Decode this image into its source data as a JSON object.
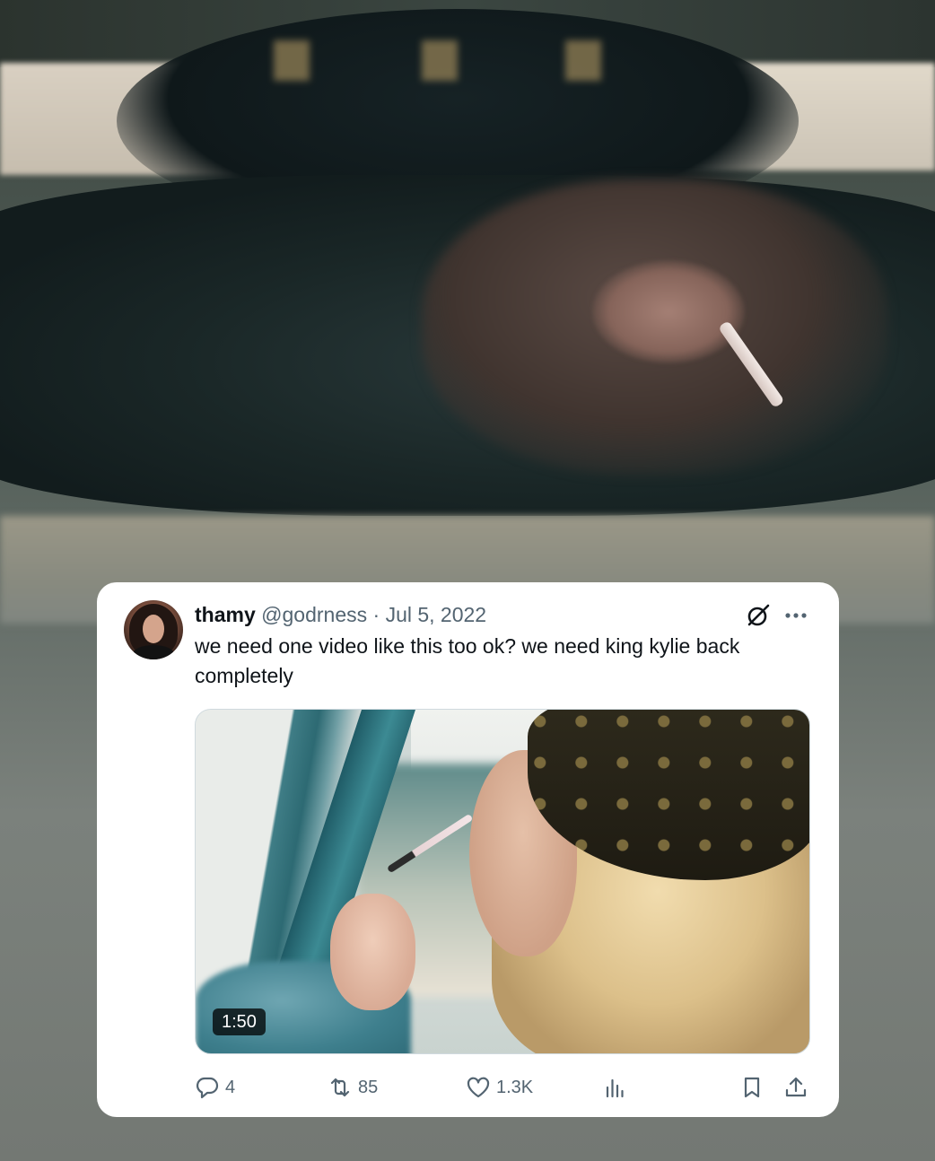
{
  "tweet": {
    "display_name": "thamy",
    "handle": "@godrness",
    "separator": "·",
    "date": "Jul 5, 2022",
    "text": "we need one video like this too ok? we need king kylie back completely",
    "media": {
      "duration": "1:50"
    },
    "stats": {
      "replies": "4",
      "reposts": "85",
      "likes": "1.3K"
    }
  },
  "colors": {
    "card_bg": "#ffffff",
    "text_primary": "#0f1419",
    "text_secondary": "#536471"
  },
  "icons": [
    "grok-icon",
    "more-icon",
    "reply-icon",
    "repost-icon",
    "like-icon",
    "views-icon",
    "bookmark-icon",
    "share-icon"
  ]
}
